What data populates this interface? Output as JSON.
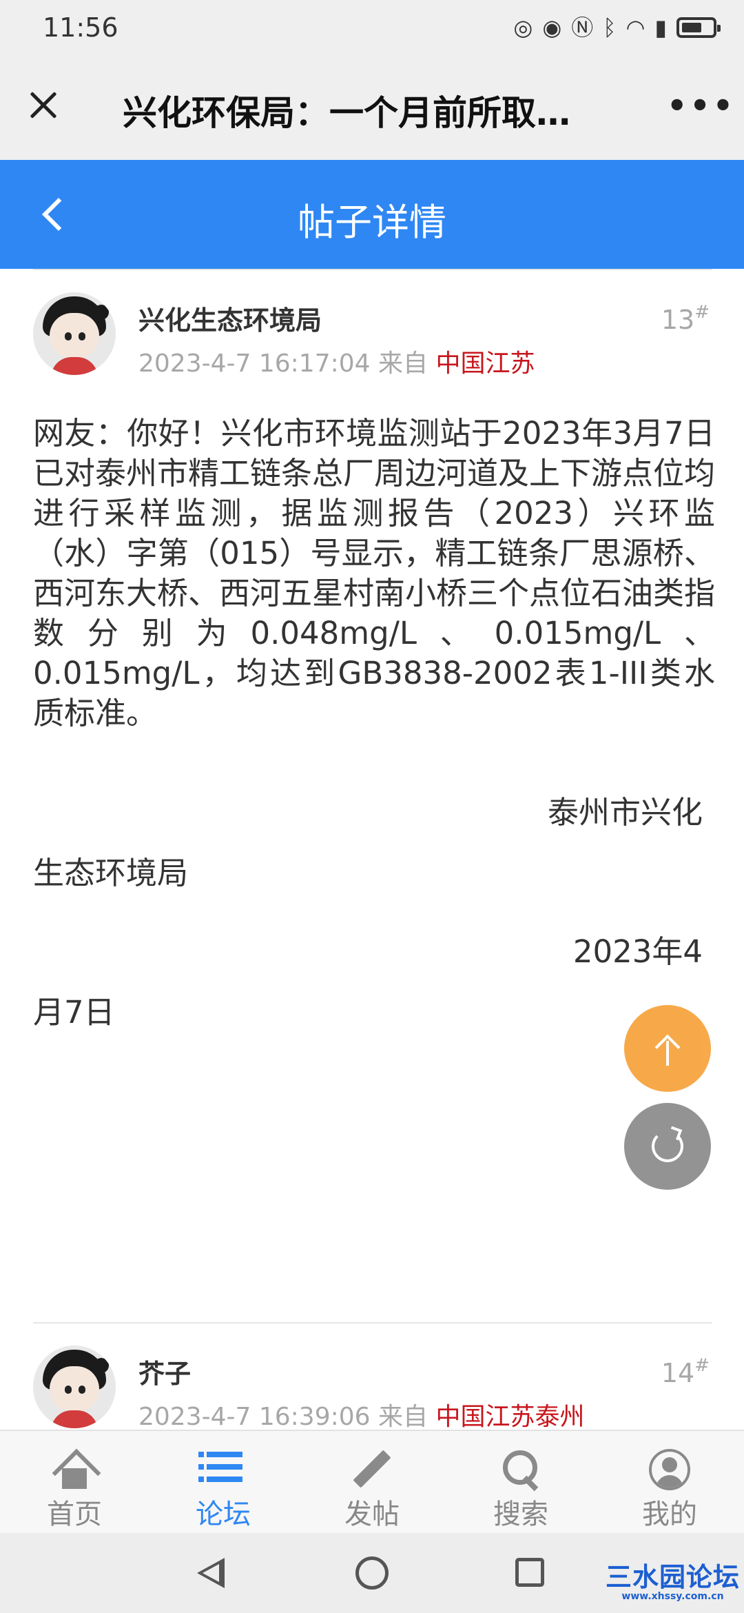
{
  "status_bar": {
    "time": "11:56"
  },
  "webview": {
    "title": "兴化环保局：一个月前所取…",
    "more_label": "•••"
  },
  "header": {
    "title": "帖子详情"
  },
  "posts": [
    {
      "username": "兴化生态环境局",
      "datetime": "2023-4-7 16:17:04",
      "from_label": "来自",
      "location": "中国江苏",
      "floor": "13",
      "floor_mark": "#",
      "content": "网友：你好！兴化市环境监测站于2023年3月7日已对泰州市精工链条总厂周边河道及上下游点位均进行采样监测，据监测报告（2023）兴环监（水）字第（015）号显示，精工链条厂思源桥、西河东大桥、西河五星村南小桥三个点位石油类指数分别为0.048mg/L、0.015mg/L、0.015mg/L，均达到GB3838-2002表1-III类水质标准。",
      "signature_part1": "泰州市兴化",
      "signature_part2": "生态环境局",
      "date_part1": "2023年4",
      "date_part2": "月7日"
    },
    {
      "username": "芥子",
      "datetime": "2023-4-7 16:39:06",
      "from_label": "来自",
      "location": "中国江苏泰州",
      "floor": "14",
      "floor_mark": "#"
    }
  ],
  "tabbar": {
    "items": [
      {
        "label": "首页",
        "icon": "home-icon"
      },
      {
        "label": "论坛",
        "icon": "list-icon"
      },
      {
        "label": "发帖",
        "icon": "pencil-icon"
      },
      {
        "label": "搜索",
        "icon": "search-icon"
      },
      {
        "label": "我的",
        "icon": "profile-icon"
      }
    ],
    "active_index": 1
  },
  "watermark": {
    "main": "三水园论坛",
    "sub": "www.xhssy.com.cn"
  },
  "colors": {
    "header_blue": "#2f87f3",
    "location_red": "#c8161d",
    "fab_orange": "#f7a23a",
    "fab_gray": "#8a8a8a"
  }
}
